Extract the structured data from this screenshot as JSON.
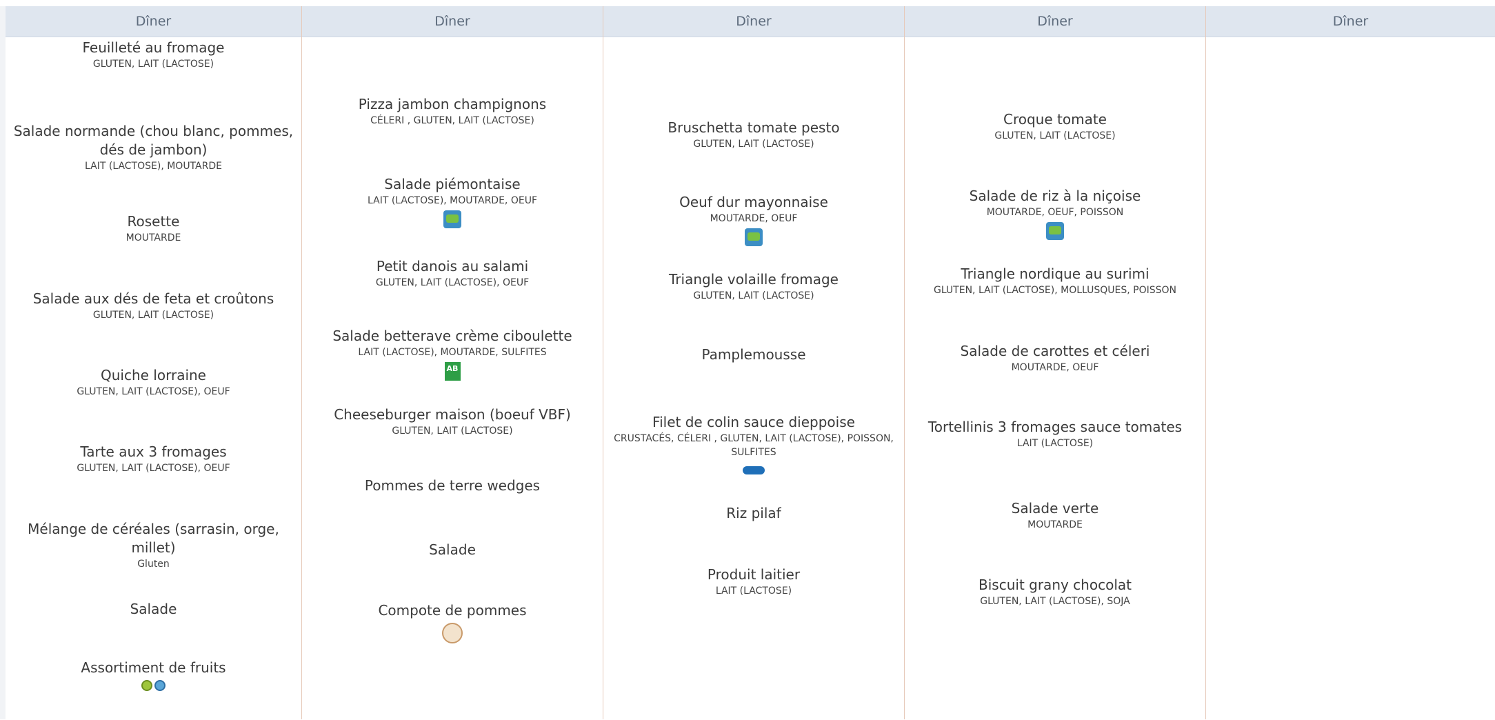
{
  "columns": [
    {
      "header": "Dîner",
      "dishes": [
        {
          "name": "Feuilleté au fromage",
          "allergens": "GLUTEN, LAIT (LACTOSE)",
          "labels": []
        },
        {
          "name": "Salade normande (chou blanc, pommes, dés de jambon)",
          "allergens": "LAIT (LACTOSE), MOUTARDE",
          "labels": []
        },
        {
          "name": "Rosette",
          "allergens": "MOUTARDE",
          "labels": []
        },
        {
          "name": "Salade aux dés de feta et croûtons",
          "allergens": "GLUTEN, LAIT (LACTOSE)",
          "labels": []
        },
        {
          "name": "Quiche lorraine",
          "allergens": "GLUTEN, LAIT (LACTOSE), OEUF",
          "labels": []
        },
        {
          "name": "Tarte aux 3 fromages",
          "allergens": "GLUTEN, LAIT (LACTOSE), OEUF",
          "labels": []
        },
        {
          "name": "Mélange de céréales (sarrasin, orge, millet)",
          "allergens": "Gluten",
          "labels": []
        },
        {
          "name": "Salade",
          "allergens": "",
          "labels": []
        },
        {
          "name": "Assortiment de fruits",
          "allergens": "",
          "labels": [
            "fruits-label-icon",
            "fruits-label-icon-2"
          ]
        }
      ]
    },
    {
      "header": "Dîner",
      "dishes": [
        {
          "name": "Pizza jambon champignons",
          "allergens": "CÉLERI , GLUTEN, LAIT (LACTOSE)",
          "labels": []
        },
        {
          "name": "Salade piémontaise",
          "allergens": "LAIT (LACTOSE), MOUTARDE, OEUF",
          "labels": [
            "bleu-blanc-coeur-icon"
          ]
        },
        {
          "name": "Petit danois au salami",
          "allergens": "GLUTEN, LAIT (LACTOSE), OEUF",
          "labels": []
        },
        {
          "name": "Salade betterave crème ciboulette",
          "allergens": "LAIT (LACTOSE), MOUTARDE, SULFITES",
          "labels": [
            "agriculture-biologique-icon"
          ]
        },
        {
          "name": "Cheeseburger maison (boeuf VBF)",
          "allergens": "GLUTEN, LAIT (LACTOSE)",
          "labels": []
        },
        {
          "name": "Pommes de terre wedges",
          "allergens": "",
          "labels": []
        },
        {
          "name": "Salade",
          "allergens": "",
          "labels": []
        },
        {
          "name": "Compote de pommes",
          "allergens": "",
          "labels": [
            "fait-maison-icon"
          ]
        }
      ]
    },
    {
      "header": "Dîner",
      "dishes": [
        {
          "name": "Bruschetta tomate pesto",
          "allergens": "GLUTEN, LAIT (LACTOSE)",
          "labels": []
        },
        {
          "name": "Oeuf dur mayonnaise",
          "allergens": "MOUTARDE, OEUF",
          "labels": [
            "bleu-blanc-coeur-icon"
          ]
        },
        {
          "name": "Triangle volaille fromage",
          "allergens": "GLUTEN, LAIT (LACTOSE)",
          "labels": []
        },
        {
          "name": "Pamplemousse",
          "allergens": "",
          "labels": []
        },
        {
          "name": "Filet de colin sauce dieppoise",
          "allergens": "CRUSTACÉS, CÉLERI , GLUTEN, LAIT (LACTOSE), POISSON, SULFITES",
          "labels": [
            "peche-durable-icon"
          ]
        },
        {
          "name": "Riz pilaf",
          "allergens": "",
          "labels": []
        },
        {
          "name": "Produit laitier",
          "allergens": "LAIT (LACTOSE)",
          "labels": []
        }
      ]
    },
    {
      "header": "Dîner",
      "dishes": [
        {
          "name": "Croque tomate",
          "allergens": "GLUTEN, LAIT (LACTOSE)",
          "labels": []
        },
        {
          "name": "Salade de riz à la niçoise",
          "allergens": "MOUTARDE, OEUF, POISSON",
          "labels": [
            "bleu-blanc-coeur-icon"
          ]
        },
        {
          "name": "Triangle nordique au surimi",
          "allergens": "GLUTEN, LAIT (LACTOSE), MOLLUSQUES, POISSON",
          "labels": []
        },
        {
          "name": "Salade de carottes et céleri",
          "allergens": "MOUTARDE, OEUF",
          "labels": []
        },
        {
          "name": "Tortellinis 3 fromages sauce tomates",
          "allergens": "LAIT (LACTOSE)",
          "labels": []
        },
        {
          "name": "Salade verte",
          "allergens": "MOUTARDE",
          "labels": []
        },
        {
          "name": "Biscuit grany chocolat",
          "allergens": "GLUTEN, LAIT (LACTOSE), SOJA",
          "labels": []
        }
      ]
    },
    {
      "header": "Dîner",
      "dishes": []
    }
  ]
}
